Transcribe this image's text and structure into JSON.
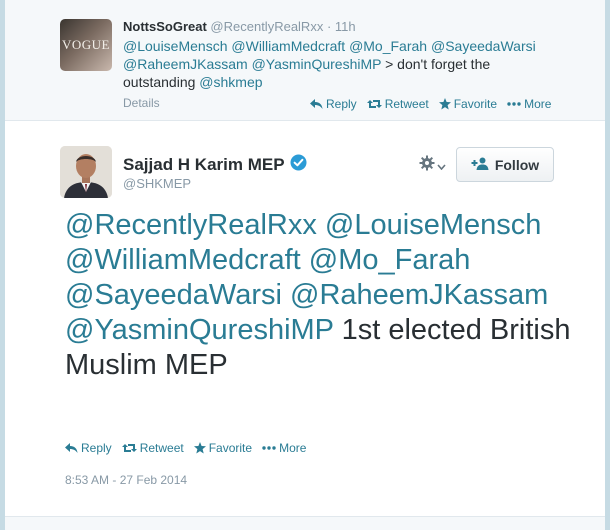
{
  "reply": {
    "name": "NottsSoGreat",
    "handle": "@RecentlyRealRxx",
    "separator": "·",
    "time": "11h",
    "avatar_text": "VOGUE",
    "text_parts": [
      {
        "text": "@LouiseMensch",
        "mention": true
      },
      {
        "text": " ",
        "mention": false
      },
      {
        "text": "@WilliamMedcraft",
        "mention": true
      },
      {
        "text": " ",
        "mention": false
      },
      {
        "text": "@Mo_Farah",
        "mention": true
      },
      {
        "text": " ",
        "mention": false
      },
      {
        "text": "@SayeedaWarsi",
        "mention": true
      },
      {
        "text": " ",
        "mention": false
      },
      {
        "text": "@RaheemJKassam",
        "mention": true
      },
      {
        "text": " ",
        "mention": false
      },
      {
        "text": "@YasminQureshiMP",
        "mention": true
      },
      {
        "text": " > don't forget the outstanding ",
        "mention": false
      },
      {
        "text": "@shkmep",
        "mention": true
      }
    ],
    "details": "Details",
    "actions": {
      "reply": "Reply",
      "retweet": "Retweet",
      "favorite": "Favorite",
      "more": "More"
    }
  },
  "main": {
    "name": "Sajjad H Karim MEP",
    "handle": "@SHKMEP",
    "follow_label": "Follow",
    "text_parts": [
      {
        "text": "@RecentlyRealRxx",
        "mention": true
      },
      {
        "text": " ",
        "mention": false
      },
      {
        "text": "@LouiseMensch",
        "mention": true
      },
      {
        "text": " ",
        "mention": false
      },
      {
        "text": "@WilliamMedcraft",
        "mention": true
      },
      {
        "text": " ",
        "mention": false
      },
      {
        "text": "@Mo_Farah",
        "mention": true
      },
      {
        "text": " ",
        "mention": false
      },
      {
        "text": "@SayeedaWarsi",
        "mention": true
      },
      {
        "text": " ",
        "mention": false
      },
      {
        "text": "@RaheemJKassam",
        "mention": true
      },
      {
        "text": " ",
        "mention": false
      },
      {
        "text": "@YasminQureshiMP",
        "mention": true
      },
      {
        "text": " 1st elected British Muslim MEP",
        "mention": false
      }
    ],
    "actions": {
      "reply": "Reply",
      "retweet": "Retweet",
      "favorite": "Favorite",
      "more": "More"
    },
    "timestamp": "8:53 AM - 27 Feb 2014"
  },
  "colors": {
    "link": "#2a7c94",
    "verified": "#2b9bd6",
    "muted": "#8899a6",
    "text": "#292f33",
    "favorite": "#2a7c94"
  },
  "icons": {
    "reply": "reply-arrow-icon",
    "retweet": "retweet-icon",
    "favorite": "star-icon",
    "more": "dots-icon",
    "verified": "verified-badge-icon",
    "settings": "gear-icon",
    "follow": "add-user-icon"
  }
}
